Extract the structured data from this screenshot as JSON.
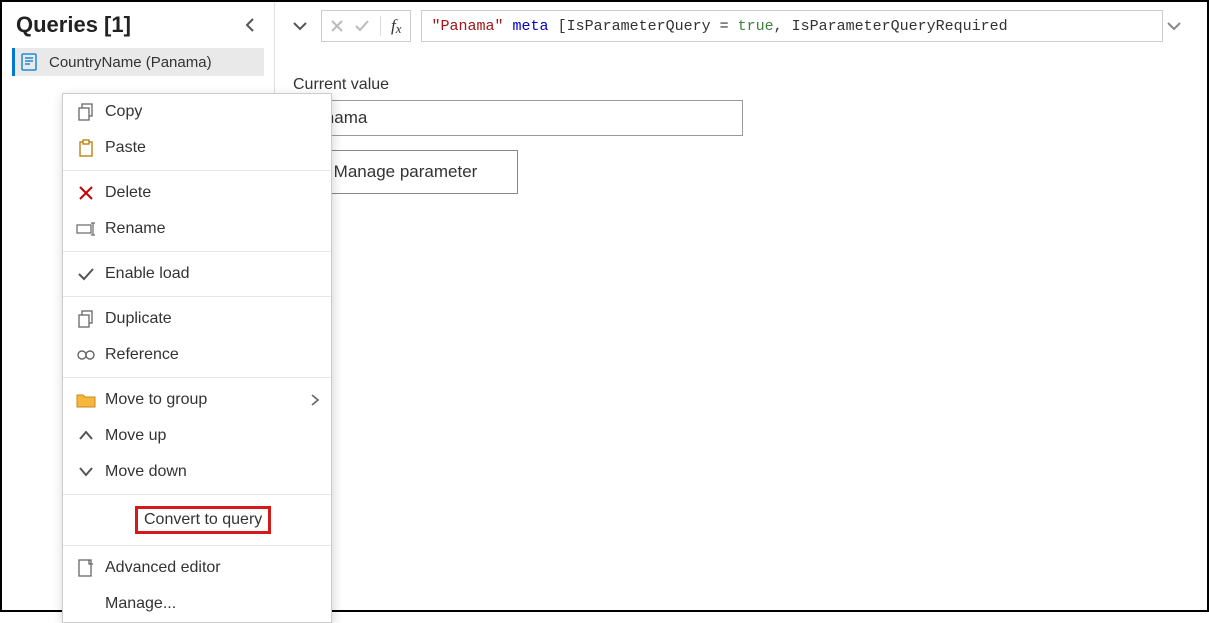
{
  "sidebar": {
    "title": "Queries [1]",
    "query_name": "CountryName (Panama)"
  },
  "formula": {
    "str": "\"Panama\"",
    "kw1": "meta",
    "plain1": " [IsParameterQuery = ",
    "const1": "true",
    "plain2": ", IsParameterQueryRequired"
  },
  "current": {
    "label": "Current value",
    "value": "Panama",
    "manage": "Manage parameter"
  },
  "menu": {
    "copy": "Copy",
    "paste": "Paste",
    "delete": "Delete",
    "rename": "Rename",
    "enable_load": "Enable load",
    "duplicate": "Duplicate",
    "reference": "Reference",
    "move_to_group": "Move to group",
    "move_up": "Move up",
    "move_down": "Move down",
    "convert": "Convert to query",
    "advanced": "Advanced editor",
    "manage": "Manage..."
  }
}
